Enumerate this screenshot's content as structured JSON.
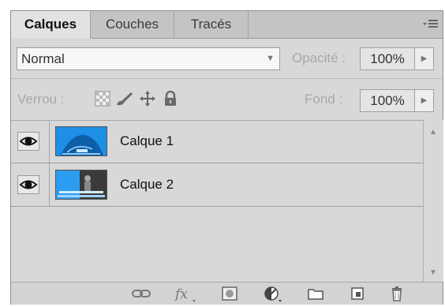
{
  "tabs": [
    {
      "label": "Calques",
      "active": true
    },
    {
      "label": "Couches",
      "active": false
    },
    {
      "label": "Tracés",
      "active": false
    }
  ],
  "panel_menu_icon": "panel-menu-icon",
  "blend": {
    "mode": "Normal",
    "opacity_label": "Opacité :",
    "opacity_value": "100%"
  },
  "lock": {
    "label": "Verrou :",
    "fill_label": "Fond :",
    "fill_value": "100%"
  },
  "layers": [
    {
      "name": "Calque 1",
      "visible": true
    },
    {
      "name": "Calque 2",
      "visible": true
    }
  ],
  "bottom_icons": [
    "link-layers-icon",
    "fx-icon",
    "add-mask-icon",
    "adjustment-layer-icon",
    "new-group-icon",
    "new-layer-icon",
    "delete-layer-icon"
  ],
  "colors": {
    "panel": "#d8d8d8",
    "tab_active": "#e2e2e2",
    "thumb_blue": "#1e8fe6"
  }
}
